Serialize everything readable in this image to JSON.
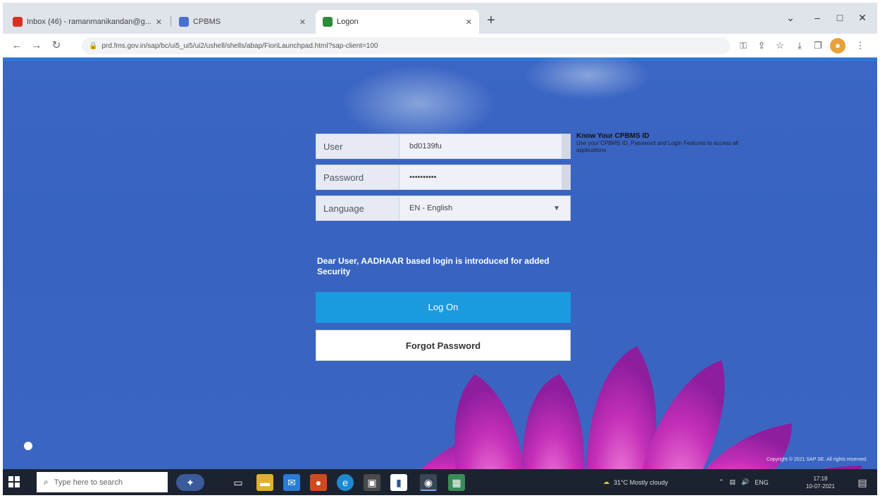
{
  "browser": {
    "tabs": [
      {
        "label": "Inbox (46) - ramanmanikandan@g...",
        "active": false
      },
      {
        "label": "CPBMS",
        "active": false
      },
      {
        "label": "Logon",
        "active": true
      }
    ],
    "new_tab": "+",
    "window_controls": {
      "minimize": "–",
      "maximize": "□",
      "close": "✕"
    },
    "url": "prd.fms.gov.in/sap/bc/ui5_ui5/ui2/ushell/shells/abap/FioriLaunchpad.html?sap-client=100",
    "toolbar_icons": [
      "key-icon",
      "share-icon",
      "star-icon",
      "download-icon",
      "window-icon",
      "profile-icon",
      "menu-icon"
    ]
  },
  "login": {
    "user_label": "User",
    "user_value": "bd0139fu",
    "password_label": "Password",
    "password_value": "••••••••••",
    "language_label": "Language",
    "language_value": "EN - English",
    "side_note_title": "Know Your CPBMS ID",
    "side_note_body": "Use your CPBMS ID, Password and Login Features to access all applications",
    "security_message": "Dear User, AADHAAR based login is introduced for added Security",
    "logon_button": "Log On",
    "forgot_button": "Forgot Password",
    "copyright": "Copyright © 2021 SAP SE. All rights reserved."
  },
  "taskbar": {
    "search_placeholder": "Type here to search",
    "weather": "31°C  Mostly cloudy",
    "language": "ENG",
    "time": "17:18",
    "date": "10-07-2021",
    "apps": [
      "task-view-icon",
      "file-explorer-icon",
      "mail-icon",
      "office-icon",
      "edge-icon",
      "store-icon",
      "word-icon",
      "chrome-icon",
      "photos-icon"
    ]
  }
}
